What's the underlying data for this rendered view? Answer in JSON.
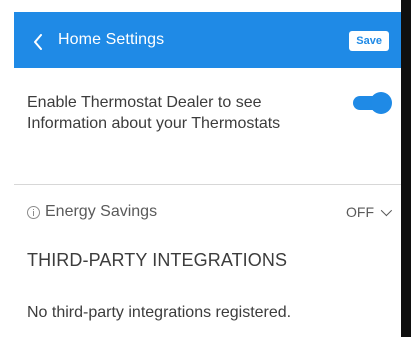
{
  "header": {
    "title": "Home Settings",
    "save_label": "Save",
    "back_icon": "chevron-left-icon",
    "background_color": "#1f8ae6"
  },
  "dealer_access": {
    "label": "Enable Thermostat Dealer to see Information about your Thermostats",
    "enabled": true,
    "toggle_color": "#1f8ae6"
  },
  "energy_savings": {
    "label": "Energy Savings",
    "value": "OFF",
    "info_icon": "info-icon",
    "dropdown_icon": "chevron-down-icon"
  },
  "integrations": {
    "section_title": "THIRD-PARTY INTEGRATIONS",
    "empty_message": "No third-party integrations registered."
  }
}
